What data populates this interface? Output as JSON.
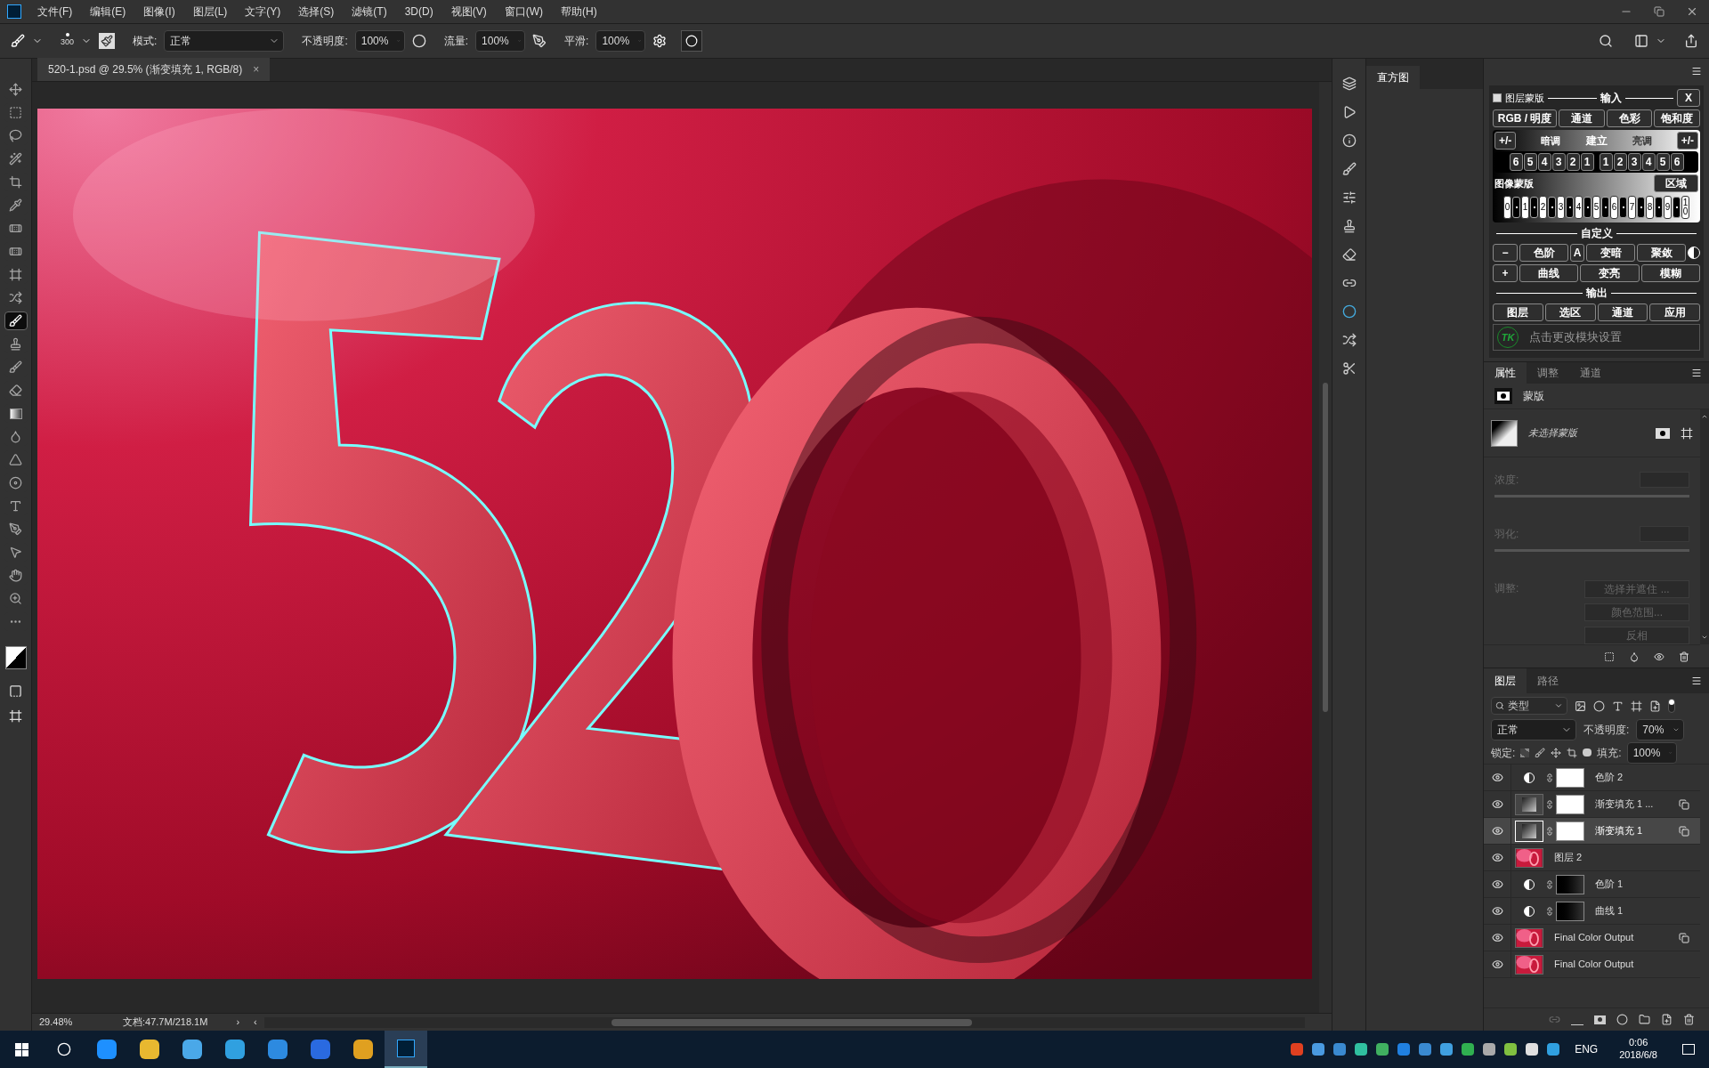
{
  "menu": [
    "文件(F)",
    "编辑(E)",
    "图像(I)",
    "图层(L)",
    "文字(Y)",
    "选择(S)",
    "滤镜(T)",
    "3D(D)",
    "视图(V)",
    "窗口(W)",
    "帮助(H)"
  ],
  "options": {
    "brush_size": "300",
    "mode_label": "模式:",
    "mode": "正常",
    "opacity_label": "不透明度:",
    "opacity": "100%",
    "flow_label": "流量:",
    "flow": "100%",
    "smooth_label": "平滑:",
    "smooth": "100%"
  },
  "document_tab": {
    "title": "520-1.psd @ 29.5% (渐变填充 1, RGB/8)",
    "close": "×"
  },
  "tools": [
    {
      "kind": "move",
      "selected": false
    },
    {
      "kind": "marquee",
      "selected": false
    },
    {
      "kind": "lasso",
      "selected": false
    },
    {
      "kind": "wand",
      "selected": false
    },
    {
      "kind": "crop",
      "selected": false
    },
    {
      "kind": "eyedropper",
      "selected": false
    },
    {
      "kind": "bandage",
      "selected": false
    },
    {
      "kind": "bandage",
      "selected": false
    },
    {
      "kind": "frame",
      "selected": false
    },
    {
      "kind": "shuffle",
      "selected": false
    },
    {
      "kind": "brush",
      "selected": true
    },
    {
      "kind": "stamp",
      "selected": false
    },
    {
      "kind": "brush",
      "selected": false
    },
    {
      "kind": "eraser",
      "selected": false
    },
    {
      "kind": "gradient",
      "selected": false
    },
    {
      "kind": "droplet",
      "selected": false
    },
    {
      "kind": "triangle",
      "selected": false
    },
    {
      "kind": "disc",
      "selected": false
    },
    {
      "kind": "type",
      "selected": false
    },
    {
      "kind": "pen",
      "selected": false
    },
    {
      "kind": "pointer",
      "selected": false
    },
    {
      "kind": "hand",
      "selected": false
    },
    {
      "kind": "zoom",
      "selected": false
    },
    {
      "kind": "more",
      "selected": false
    }
  ],
  "histogram": {
    "title": "直方图"
  },
  "plugin": {
    "mask_checkbox": {
      "label": "图层蒙版",
      "checked": false
    },
    "input_title": "输入",
    "close": "X",
    "input_buttons": [
      "RGB / 明度",
      "通道",
      "色彩",
      "饱和度"
    ],
    "plus_minus_left": "+/-",
    "shadows": "暗调",
    "build": "建立",
    "highlights": "亮调",
    "plus_minus_right": "+/-",
    "left_steps": [
      "6",
      "5",
      "4",
      "3",
      "2",
      "1"
    ],
    "right_steps": [
      "1",
      "2",
      "3",
      "4",
      "5",
      "6"
    ],
    "image_mask": "图像蒙版",
    "zone": "区域",
    "keys": [
      "0",
      "1",
      "2",
      "3",
      "4",
      "5",
      "6",
      "7",
      "8",
      "9",
      "10"
    ],
    "custom_title": "自定义",
    "minus": "−",
    "levels": "色阶",
    "auto": "A",
    "darken": "变暗",
    "converge": "聚敛",
    "plus": "+",
    "curves": "曲线",
    "lighten": "变亮",
    "blur": "模糊",
    "output_title": "输出",
    "output_buttons": [
      "图层",
      "选区",
      "通道",
      "应用"
    ],
    "logo": "TK",
    "settings": "点击更改模块设置"
  },
  "properties": {
    "tabs": [
      {
        "label": "属性",
        "selected": true
      },
      {
        "label": "调整",
        "selected": false
      },
      {
        "label": "通道",
        "selected": false
      }
    ],
    "type_label": "蒙版",
    "mask_status": "未选择蒙版",
    "density_label": "浓度:",
    "feather_label": "羽化:",
    "adjust_label": "调整:",
    "buttons": [
      "选择并遮住 ...",
      "颜色范围...",
      "反相"
    ]
  },
  "layers": {
    "tabs": [
      {
        "label": "图层",
        "selected": true
      },
      {
        "label": "路径",
        "selected": false
      }
    ],
    "filter": "类型",
    "blend_mode": "正常",
    "opacity_label": "不透明度:",
    "opacity": "70%",
    "lock_label": "锁定:",
    "fill_label": "填充:",
    "fill": "100%",
    "items": [
      {
        "name": "色阶 2",
        "kind": "adjustment",
        "mask_white": true,
        "linked_badge": false,
        "visible": true,
        "selected": false
      },
      {
        "name": "渐变填充 1 ...",
        "kind": "fill",
        "mask_white": true,
        "linked_badge": true,
        "visible": true,
        "selected": false
      },
      {
        "name": "渐变填充 1",
        "kind": "fill",
        "mask_white": true,
        "linked_badge": true,
        "visible": true,
        "selected": true
      },
      {
        "name": "图层 2",
        "kind": "pixel",
        "linked_badge": false,
        "visible": true,
        "selected": false
      },
      {
        "name": "色阶 1",
        "kind": "adjustment",
        "mask_white": false,
        "linked_badge": false,
        "visible": true,
        "selected": false
      },
      {
        "name": "曲线 1",
        "kind": "adjustment",
        "mask_white": false,
        "linked_badge": false,
        "visible": true,
        "selected": false
      },
      {
        "name": "Final Color Output",
        "kind": "pixel",
        "linked_badge": true,
        "visible": true,
        "selected": false
      },
      {
        "name": "Final Color Output",
        "kind": "pixel",
        "linked_badge": false,
        "visible": true,
        "selected": false
      }
    ]
  },
  "status": {
    "zoom": "29.48%",
    "doc": "文档:47.7M/218.1M",
    "arrow": "›",
    "left_arrow": "‹"
  },
  "taskbar": {
    "lang": "ENG",
    "time": "0:06",
    "date": "2018/6/8"
  }
}
